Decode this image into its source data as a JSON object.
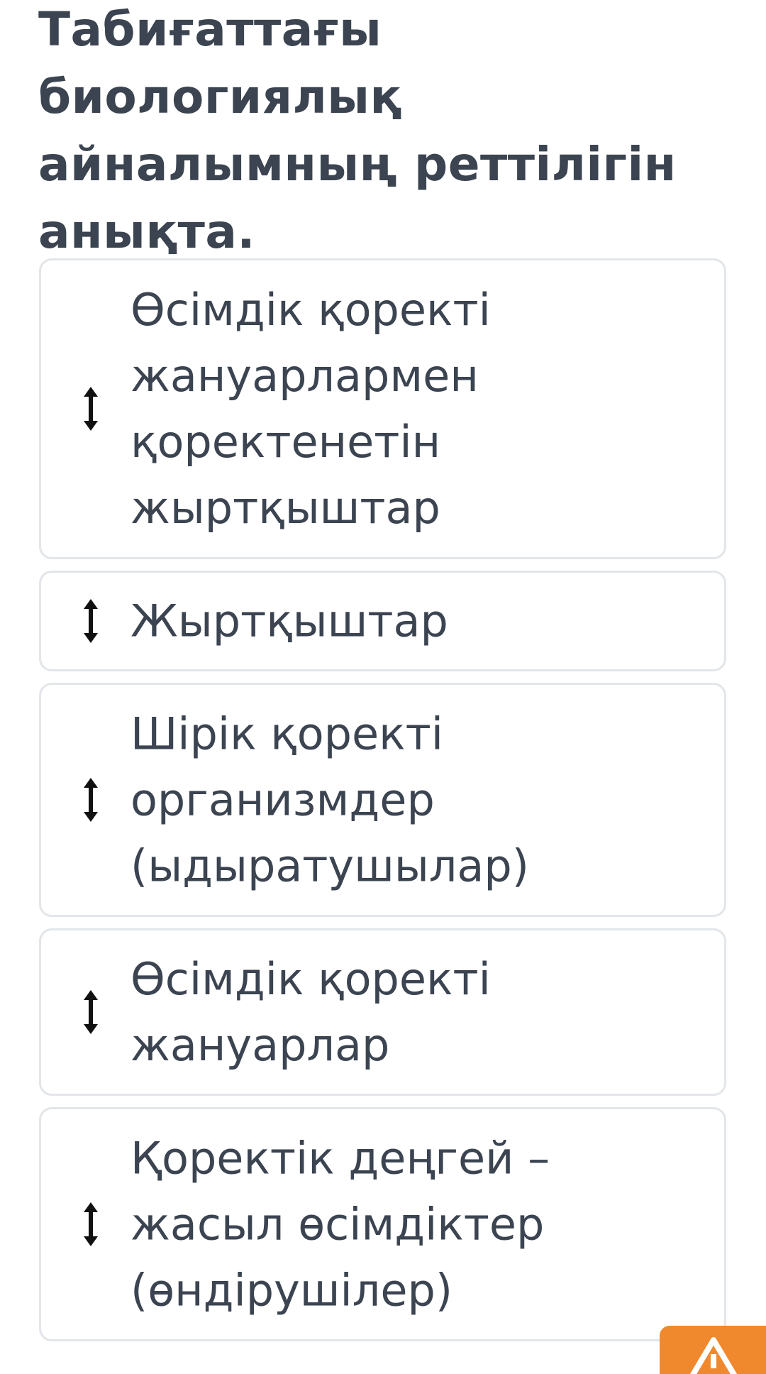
{
  "question": {
    "title_lines": [
      "Табиғаттағы",
      "биологиялық",
      "айналымның реттілігін",
      "анықта."
    ]
  },
  "cards": [
    {
      "lines": [
        "Өсімдік қоректі",
        "жануарлармен",
        "қоректенетін",
        "жыртқыштар"
      ],
      "icon": "up-down-arrow-icon"
    },
    {
      "lines": [
        "Жыртқыштар"
      ],
      "icon": "up-down-arrow-icon"
    },
    {
      "lines": [
        "Шірік қоректі",
        "организмдер",
        "(ыдыратушылар)"
      ],
      "icon": "up-down-arrow-icon"
    },
    {
      "lines": [
        "Өсімдік қоректі",
        "жануарлар"
      ],
      "icon": "up-down-arrow-icon"
    },
    {
      "lines": [
        "Қоректік деңгей –",
        "жасыл өсімдіктер",
        "(өндірушілер)"
      ],
      "icon": "up-down-arrow-icon"
    }
  ],
  "colors": {
    "text": "#3b4450",
    "card_border": "#e3e6e9",
    "accent": "#f0892e"
  },
  "corner_button": {
    "icon": "warning-icon"
  }
}
